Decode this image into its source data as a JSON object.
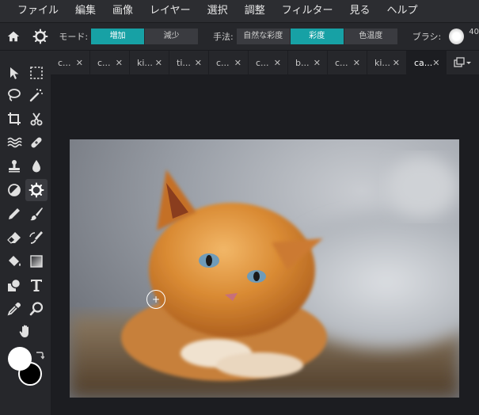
{
  "menu": [
    "ファイル",
    "編集",
    "画像",
    "レイヤー",
    "選択",
    "調整",
    "フィルター",
    "見る",
    "ヘルプ"
  ],
  "options": {
    "mode_label": "モード:",
    "mode_buttons": [
      "増加",
      "減少"
    ],
    "mode_active": 0,
    "method_label": "手法:",
    "method_buttons": [
      "自然な彩度",
      "彩度",
      "色温度"
    ],
    "method_active": 1,
    "brush_label": "ブラシ:",
    "brush_size": "40"
  },
  "tabs": [
    "c...",
    "c...",
    "ki...",
    "ti...",
    "c...",
    "c...",
    "b...",
    "c...",
    "ki...",
    "ca..."
  ],
  "active_tab": 9,
  "colors": {
    "accent": "#17a1a5",
    "foreground": "#ffffff",
    "background": "#000000"
  },
  "photo": {
    "subject": "orange kitten"
  }
}
